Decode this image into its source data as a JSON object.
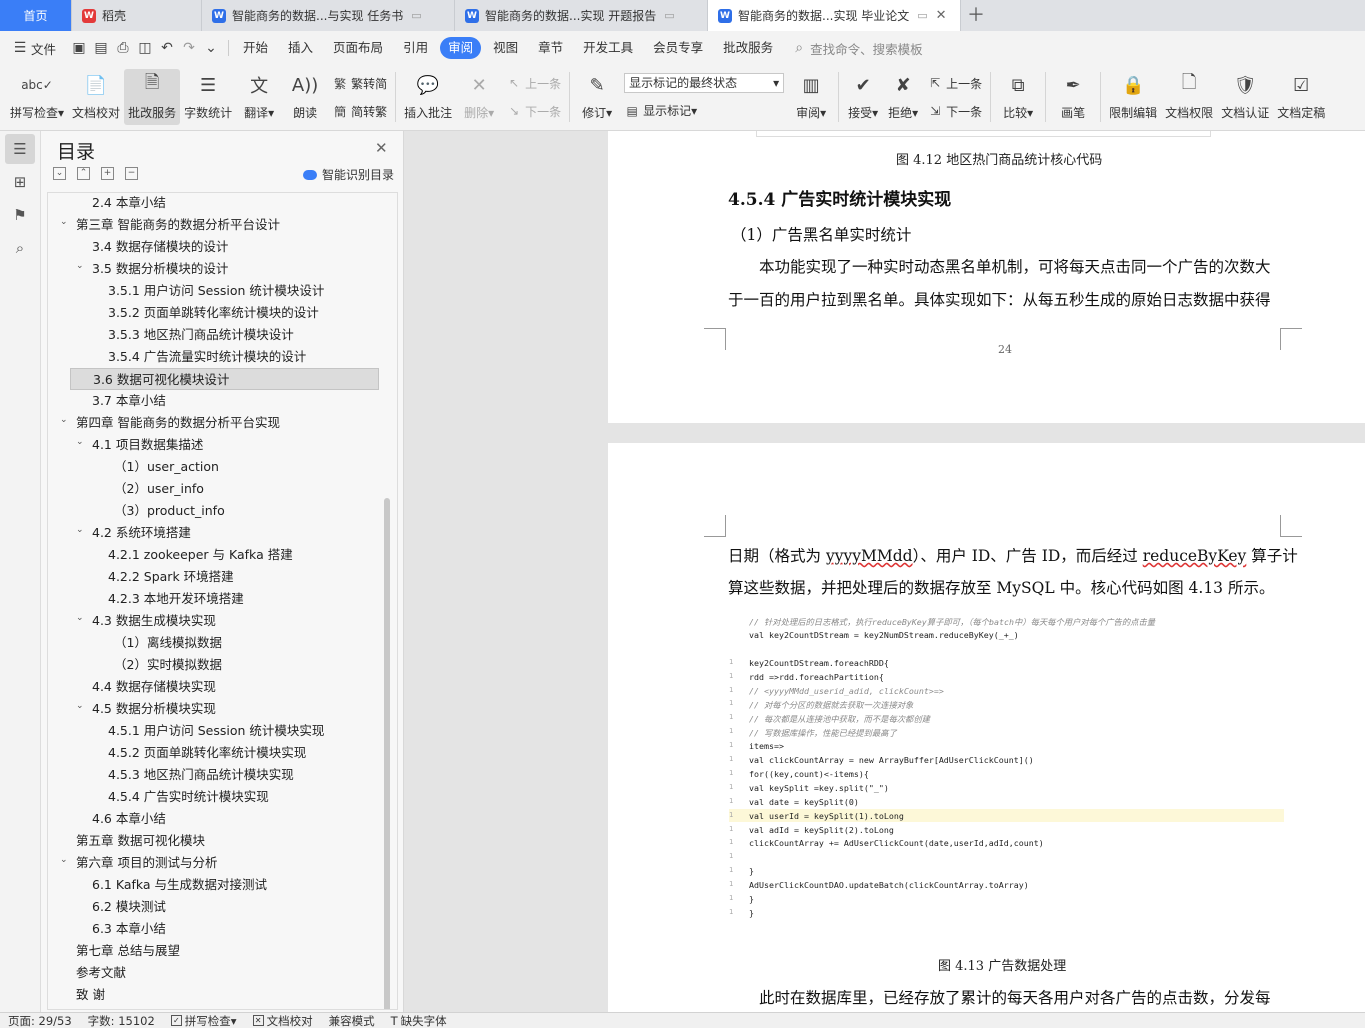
{
  "tabs": {
    "home": "首页",
    "daoke": "稻壳",
    "doc1": "智能商务的数据...与实现 任务书",
    "doc2": "智能商务的数据...实现 开题报告",
    "doc3": "智能商务的数据...实现 毕业论文"
  },
  "menu": {
    "file": "文件",
    "items": [
      "开始",
      "插入",
      "页面布局",
      "引用",
      "审阅",
      "视图",
      "章节",
      "开发工具",
      "会员专享",
      "批改服务"
    ],
    "active": "审阅",
    "search": "查找命令、搜索模板"
  },
  "ribbon": {
    "spell": "拼写检查",
    "doccheck": "文档校对",
    "correct": "批改服务",
    "wordcount": "字数统计",
    "translate": "翻译",
    "read": "朗读",
    "trad": "繁转简",
    "simp": "简转繁",
    "insert_comment": "插入批注",
    "delete": "删除",
    "prev": "上一条",
    "next": "下一条",
    "revise": "修订",
    "markup_select": "显示标记的最终状态",
    "show_markup": "显示标记",
    "review": "审阅",
    "accept": "接受",
    "reject": "拒绝",
    "prev2": "上一条",
    "next2": "下一条",
    "compare": "比较",
    "pen": "画笔",
    "restrict": "限制编辑",
    "permission": "文档权限",
    "certify": "文档认证",
    "finalize": "文档定稿"
  },
  "toc": {
    "title": "目录",
    "smart": "智能识别目录",
    "items": [
      "2.4  本章小结",
      "第三章  智能商务的数据分析平台设计",
      "3.4 数据存储模块的设计",
      "3.5 数据分析模块的设计",
      "3.5.1  用户访问 Session 统计模块设计",
      "3.5.2  页面单跳转化率统计模块的设计",
      "3.5.3  地区热门商品统计模块设计",
      "3.5.4 广告流量实时统计模块的设计",
      "3.6 数据可视化模块设计",
      "3.7  本章小结",
      "第四章  智能商务的数据分析平台实现",
      "4.1 项目数据集描述",
      "（1）user_action",
      "（2）user_info",
      "（3）product_info",
      "4.2 系统环境搭建",
      "4.2.1 zookeeper 与 Kafka 搭建",
      "4.2.2 Spark 环境搭建",
      "4.2.3 本地开发环境搭建",
      "4.3 数据生成模块实现",
      "（1）离线模拟数据",
      "（2）实时模拟数据",
      "4.4 数据存储模块实现",
      "4.5 数据分析模块实现",
      "4.5.1 用户访问 Session 统计模块实现",
      "4.5.2 页面单跳转化率统计模块实现",
      "4.5.3 地区热门商品统计模块实现",
      "4.5.4 广告实时统计模块实现",
      "4.6  本章小结",
      "第五章  数据可视化模块",
      "第六章  项目的测试与分析",
      "6.1 Kafka 与生成数据对接测试",
      "6.2 模块测试",
      "6.3 本章小结",
      "第七章  总结与展望",
      "参考文献",
      "致    谢"
    ]
  },
  "page1": {
    "fig_caption": "图 4.12 地区热门商品统计核心代码",
    "heading": "4.5.4 广告实时统计模块实现",
    "sub": "（1）广告黑名单实时统计",
    "p1": "本功能实现了一种实时动态黑名单机制，可将每天点击同一个广告的次数大",
    "p2": "于一百的用户拉到黑名单。具体实现如下：从每五秒生成的原始日志数据中获得",
    "page_no": "24"
  },
  "page2": {
    "p1a": "日期（格式为 ",
    "p1b": "yyyyMMdd",
    "p1c": "）、用户 ID、广告 ID，而后经过 ",
    "p1d": "reduceByKey",
    "p1e": " 算子计",
    "p2": "算这些数据，并把处理后的数据存放至 MySQL 中。核心代码如图 4.13 所示。",
    "code": [
      "// 针对处理后的日志格式，执行reduceByKey算子即可，（每个batch中）每天每个用户对每个广告的点击量",
      "val key2CountDStream = key2NumDStream.reduceByKey(_+_)",
      "",
      "key2CountDStream.foreachRDD{",
      "  rdd =>rdd.foreachPartition{",
      "    // <yyyyMMdd_userid_adid, clickCount>=>",
      "    // 对每个分区的数据就去获取一次连接对象",
      "    // 每次都是从连接池中获取，而不是每次都创建",
      "    // 写数据库操作，性能已经提到最高了",
      "    items=>",
      "      val clickCountArray = new ArrayBuffer[AdUserClickCount]()",
      "      for((key,count)<-items){",
      "        val keySplit =key.split(\"_\")",
      "        val date = keySplit(0)",
      "        val userId = keySplit(1).toLong",
      "        val adId = keySplit(2).toLong",
      "        clickCountArray += AdUserClickCount(date,userId,adId,count)",
      "",
      "      }",
      "      AdUserClickCountDAO.updateBatch(clickCountArray.toArray)",
      "  }",
      "}"
    ],
    "fig_caption": "图 4.13  广告数据处理",
    "p3": "此时在数据库里，已经存放了累计的每天各用户对各广告的点击数，分发每"
  },
  "status": {
    "page": "页面: 29/53",
    "words": "字数: 15102",
    "spell": "拼写检查",
    "check": "文档校对",
    "compat": "兼容模式",
    "font": "缺失字体"
  }
}
